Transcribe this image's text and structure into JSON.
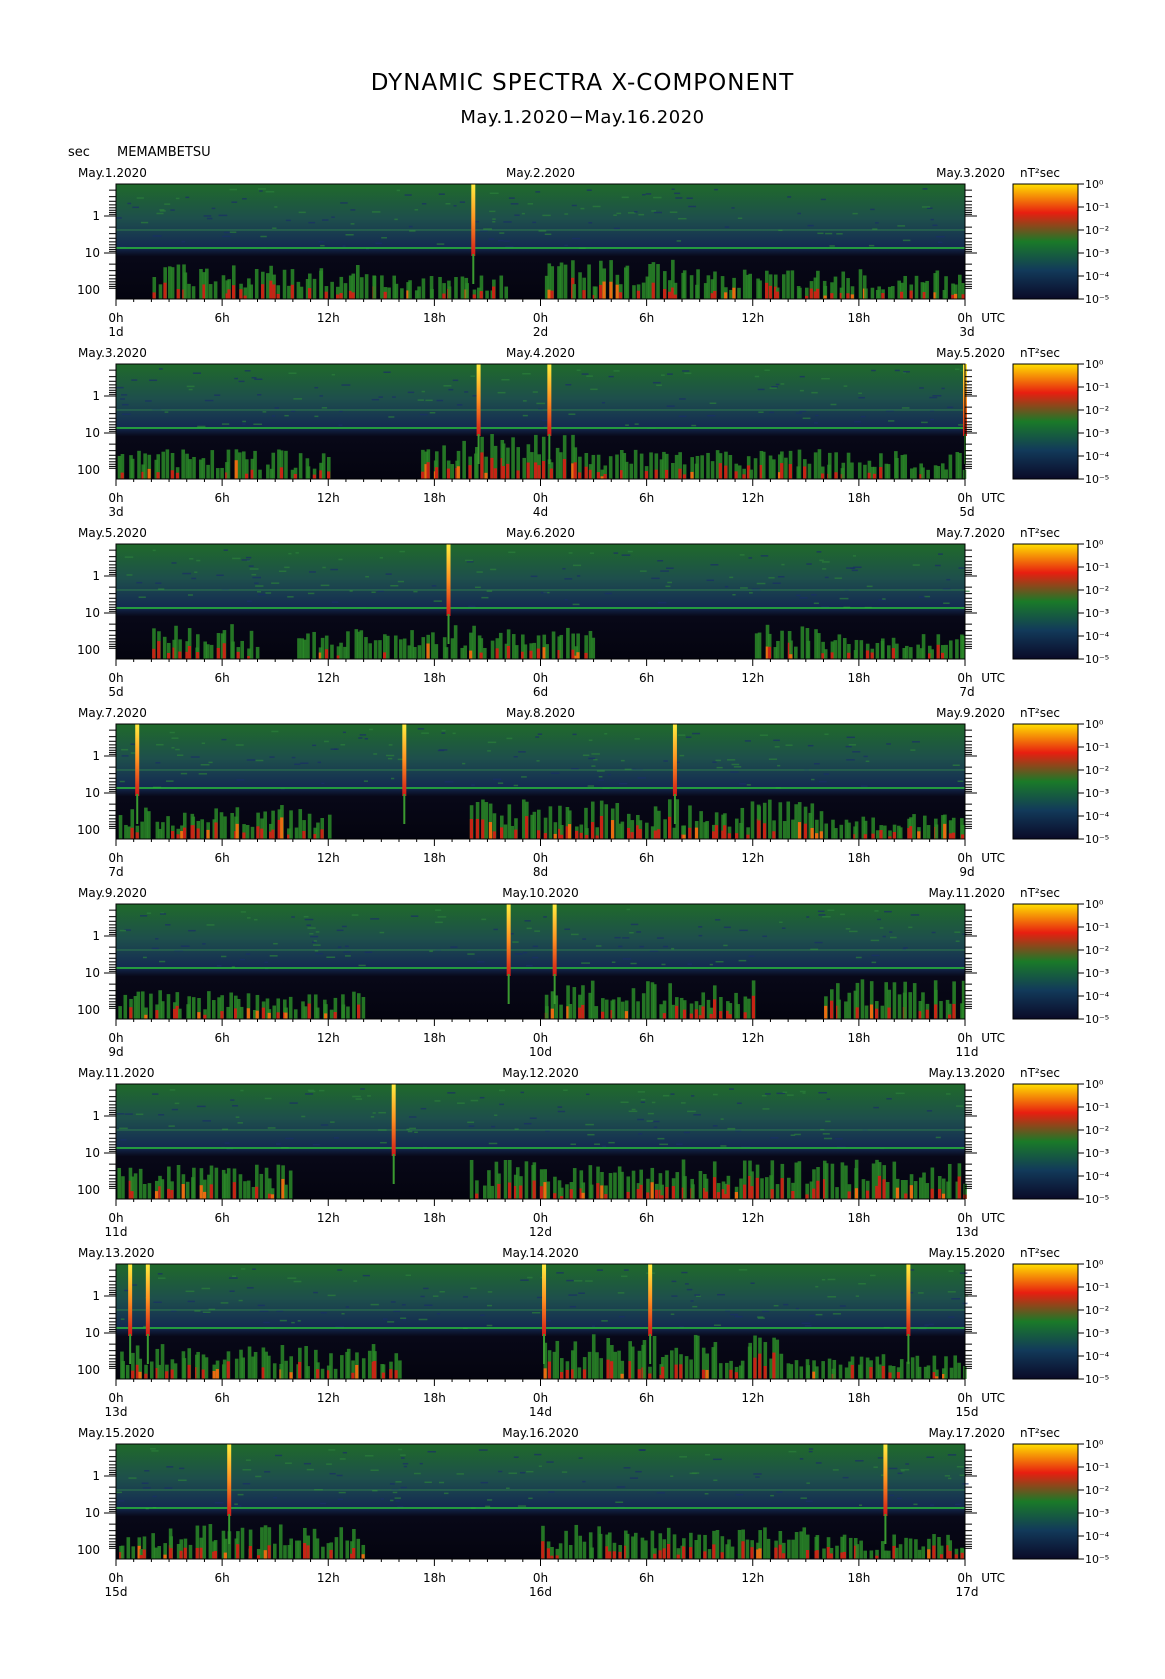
{
  "title": "DYNAMIC SPECTRA X-COMPONENT",
  "subtitle": "May.1.2020−May.16.2020",
  "y_unit": "sec",
  "station": "MEMAMBETSU",
  "chart_data": {
    "type": "heatmap",
    "colormap": [
      "#0a0a28",
      "#123a5a",
      "#1a7a28",
      "#e81e10",
      "#ffe000"
    ],
    "y_ticks": [
      "1",
      "10",
      "100"
    ],
    "x_ticks": [
      "0h",
      "6h",
      "12h",
      "18h",
      "0h",
      "6h",
      "12h",
      "18h",
      "0h"
    ],
    "utc_label": "UTC",
    "colorbar_unit": "nT²sec",
    "colorbar_ticks": [
      "10⁰",
      "10⁻¹",
      "10⁻²",
      "10⁻³",
      "10⁻⁴",
      "10⁻⁵"
    ],
    "panels": [
      {
        "date_left": "May.1.2020",
        "date_mid": "May.2.2020",
        "date_right": "May.3.2020",
        "day_left": "1d",
        "day_mid": "2d",
        "day_right": "3d",
        "spikes": [
          20.2
        ],
        "activity": [
          [
            2,
            14,
            0.6
          ],
          [
            14,
            22,
            0.4
          ],
          [
            24,
            32,
            0.7
          ],
          [
            32,
            48,
            0.5
          ]
        ]
      },
      {
        "date_left": "May.3.2020",
        "date_mid": "May.4.2020",
        "date_right": "May.5.2020",
        "day_left": "3d",
        "day_mid": "4d",
        "day_right": "5d",
        "spikes": [
          20.5,
          24.5,
          48.0
        ],
        "activity": [
          [
            0,
            12,
            0.5
          ],
          [
            17,
            26,
            0.8
          ],
          [
            26,
            48,
            0.5
          ]
        ]
      },
      {
        "date_left": "May.5.2020",
        "date_mid": "May.6.2020",
        "date_right": "May.7.2020",
        "day_left": "5d",
        "day_mid": "6d",
        "day_right": "7d",
        "spikes": [
          18.8
        ],
        "activity": [
          [
            2,
            8,
            0.6
          ],
          [
            10,
            18,
            0.5
          ],
          [
            18,
            27,
            0.6
          ],
          [
            36,
            40,
            0.6
          ],
          [
            40,
            48,
            0.4
          ]
        ]
      },
      {
        "date_left": "May.7.2020",
        "date_mid": "May.8.2020",
        "date_right": "May.9.2020",
        "day_left": "7d",
        "day_mid": "8d",
        "day_right": "9d",
        "spikes": [
          1.2,
          16.3,
          31.6
        ],
        "activity": [
          [
            0,
            12,
            0.6
          ],
          [
            20,
            40,
            0.7
          ],
          [
            40,
            48,
            0.4
          ]
        ]
      },
      {
        "date_left": "May.9.2020",
        "date_mid": "May.10.2020",
        "date_right": "May.11.2020",
        "day_left": "9d",
        "day_mid": "10d",
        "day_right": "11d",
        "spikes": [
          22.2,
          24.8
        ],
        "activity": [
          [
            0,
            14,
            0.5
          ],
          [
            24,
            36,
            0.7
          ],
          [
            40,
            48,
            0.7
          ]
        ]
      },
      {
        "date_left": "May.11.2020",
        "date_mid": "May.12.2020",
        "date_right": "May.13.2020",
        "day_left": "11d",
        "day_mid": "12d",
        "day_right": "13d",
        "spikes": [
          15.7
        ],
        "activity": [
          [
            0,
            10,
            0.6
          ],
          [
            20,
            48,
            0.7
          ]
        ]
      },
      {
        "date_left": "May.13.2020",
        "date_mid": "May.14.2020",
        "date_right": "May.15.2020",
        "day_left": "13d",
        "day_mid": "14d",
        "day_right": "15d",
        "spikes": [
          0.8,
          1.8,
          24.2,
          30.2,
          44.8
        ],
        "activity": [
          [
            0,
            16,
            0.6
          ],
          [
            24,
            38,
            0.8
          ],
          [
            38,
            48,
            0.4
          ]
        ]
      },
      {
        "date_left": "May.15.2020",
        "date_mid": "May.16.2020",
        "date_right": "May.17.2020",
        "day_left": "15d",
        "day_mid": "16d",
        "day_right": "17d",
        "spikes": [
          6.4,
          43.5
        ],
        "activity": [
          [
            0,
            14,
            0.6
          ],
          [
            24,
            40,
            0.6
          ],
          [
            40,
            48,
            0.4
          ]
        ]
      }
    ]
  }
}
